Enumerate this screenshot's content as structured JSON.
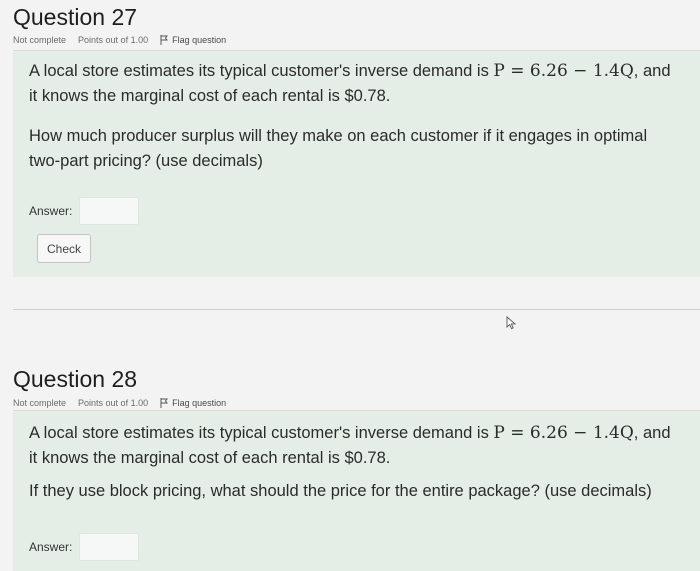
{
  "q27": {
    "title": "Question 27",
    "status": "Not complete",
    "points": "Points out of 1.00",
    "flag": "Flag question",
    "line1_pre": "A local store estimates its typical customer's inverse demand is ",
    "formula": "P = 6.26 − 1.4Q",
    "line1_post": ", and",
    "line2": "it knows the marginal cost of each rental is $0.78.",
    "prompt_line1": "How much producer surplus will they make on each customer if it engages in optimal",
    "prompt_line2": "two-part pricing? (use decimals)",
    "answer_label": "Answer:",
    "answer_value": "",
    "check_label": "Check"
  },
  "q28": {
    "title": "Question 28",
    "status": "Not complete",
    "points": "Points out of 1.00",
    "flag": "Flag question",
    "line1_pre": "A local store estimates its typical customer's inverse demand is ",
    "formula": "P = 6.26 − 1.4Q",
    "line1_post": ", and",
    "line2": "it knows the marginal cost of each rental is $0.78.",
    "prompt_line1": "If they use block pricing, what should the price for the entire package? (use decimals)",
    "answer_label": "Answer:",
    "answer_value": ""
  }
}
